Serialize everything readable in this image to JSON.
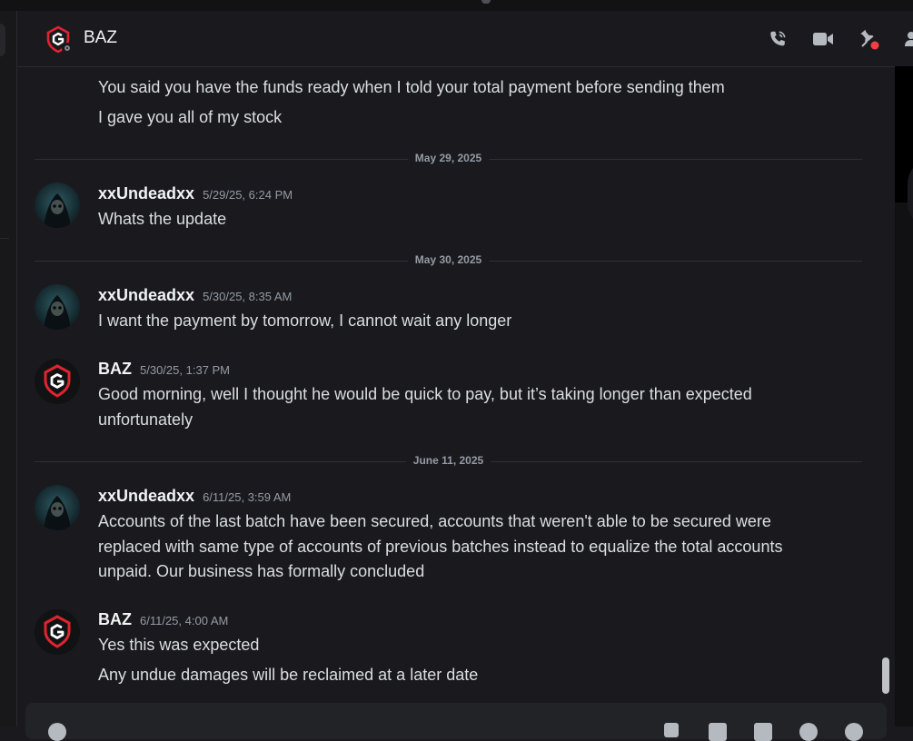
{
  "header": {
    "title": "BAZ"
  },
  "messages": {
    "m1_line1": "You said you have the funds ready when I told your total payment before sending them",
    "m1_line2": "I gave you all of my stock",
    "div1": "May 29, 2025",
    "m2_author": "xxUndeadxx",
    "m2_time": "5/29/25, 6:24 PM",
    "m2_text": "Whats the update",
    "div2": "May 30, 2025",
    "m3_author": "xxUndeadxx",
    "m3_time": "5/30/25, 8:35 AM",
    "m3_text": "I want the payment by tomorrow, I cannot wait any longer",
    "m4_author": "BAZ",
    "m4_time": "5/30/25, 1:37 PM",
    "m4_line1": "Good morning, well I thought he would be quick to pay, but it’s taking longer than expected",
    "m4_line2": "unfortunately",
    "div3": "June 11, 2025",
    "m5_author": "xxUndeadxx",
    "m5_time": "6/11/25, 3:59 AM",
    "m5_line1": "Accounts of the last batch have been secured, accounts that weren't able to be secured were",
    "m5_line2": "replaced with same type of accounts of previous batches instead to equalize the total accounts",
    "m5_line3": "unpaid. Our business has formally concluded",
    "m6_author": "BAZ",
    "m6_time": "6/11/25, 4:00 AM",
    "m6_line1": "Yes this was expected",
    "m6_line2": "Any undue damages will be reclaimed at a later date"
  },
  "icons": {
    "call": "phone-call-icon",
    "video": "video-camera-icon",
    "pin": "pin-icon",
    "members": "members-icon",
    "status": "offline-status-icon"
  },
  "colors": {
    "background": "#1a1a1e",
    "text": "#dbdee1",
    "muted": "#949ba4",
    "accent_red": "#e0242f",
    "notification_dot": "#f23f43"
  }
}
